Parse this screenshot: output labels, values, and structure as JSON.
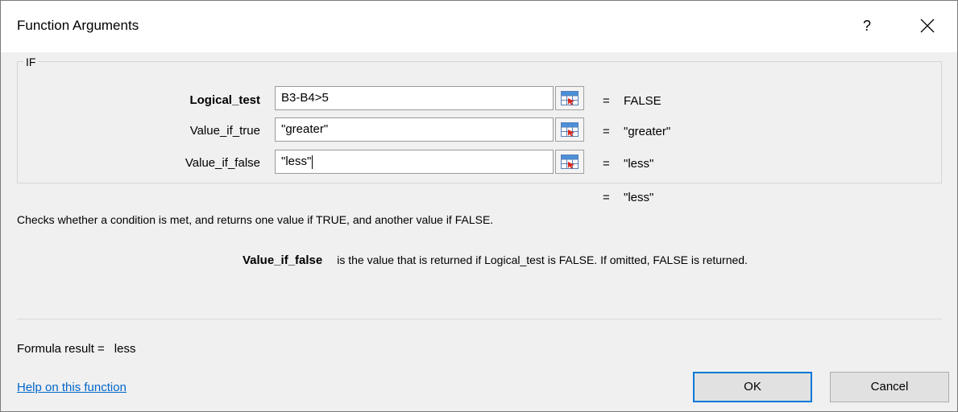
{
  "window": {
    "title": "Function Arguments",
    "help_label": "?"
  },
  "function": {
    "name": "IF",
    "args": [
      {
        "label": "Logical_test",
        "value": "B3-B4>5",
        "result": "FALSE"
      },
      {
        "label": "Value_if_true",
        "value": "\"greater\"",
        "result": "\"greater\""
      },
      {
        "label": "Value_if_false",
        "value": "\"less\"",
        "result": "\"less\""
      }
    ],
    "eq_sign": "=",
    "overall_result": "\"less\""
  },
  "description": "Checks whether a condition is met, and returns one value if TRUE, and another value if FALSE.",
  "arg_help": {
    "name": "Value_if_false",
    "text": "is the value that is returned if Logical_test is FALSE. If omitted, FALSE is returned."
  },
  "formula_result": {
    "label": "Formula result =",
    "value": "less"
  },
  "footer": {
    "help_link": "Help on this function",
    "ok_label": "OK",
    "cancel_label": "Cancel"
  },
  "colors": {
    "link": "#0066cc",
    "default_button_border": "#0078d7"
  },
  "icons": {
    "close": "close-icon",
    "ref": "collapse-dialog-icon"
  }
}
